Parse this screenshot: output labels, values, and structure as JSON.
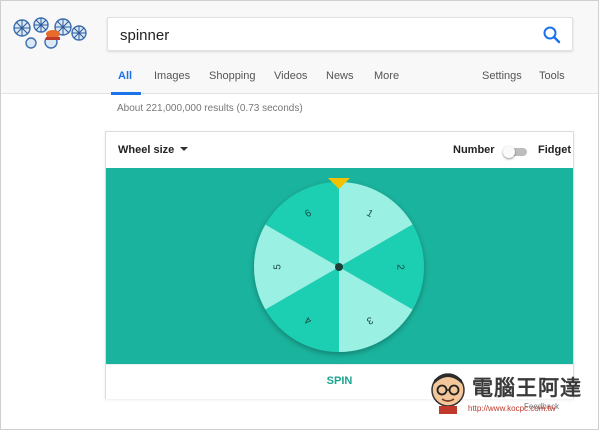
{
  "search": {
    "query": "spinner",
    "icon": "search-icon"
  },
  "doodle": {
    "icon": "google-doodle-snowflakes"
  },
  "tabs": [
    {
      "label": "All",
      "active": true
    },
    {
      "label": "Images"
    },
    {
      "label": "Shopping"
    },
    {
      "label": "Videos"
    },
    {
      "label": "News"
    },
    {
      "label": "More"
    }
  ],
  "tools": {
    "settings": "Settings",
    "tools": "Tools"
  },
  "result_stats": "About 221,000,000 results (0.73 seconds)",
  "spinner": {
    "wheel_size_label": "Wheel size",
    "mode_left": "Number",
    "mode_right": "Fidget",
    "mode_fidget_on": false,
    "wheel_numbers": [
      "1",
      "2",
      "3",
      "4",
      "5",
      "6"
    ],
    "pointer_color": "#f2c200",
    "stage_color": "#1ab39d",
    "segment_colors": [
      "#9af0e2",
      "#1fcfb2"
    ],
    "spin_label": "SPIN"
  },
  "feedback": "Feedback",
  "watermark": {
    "title": "電腦王阿達",
    "url": "http://www.kocpc.com.tw"
  },
  "colors": {
    "accent": "#1a73e8",
    "spin_text": "#1aa58f"
  }
}
